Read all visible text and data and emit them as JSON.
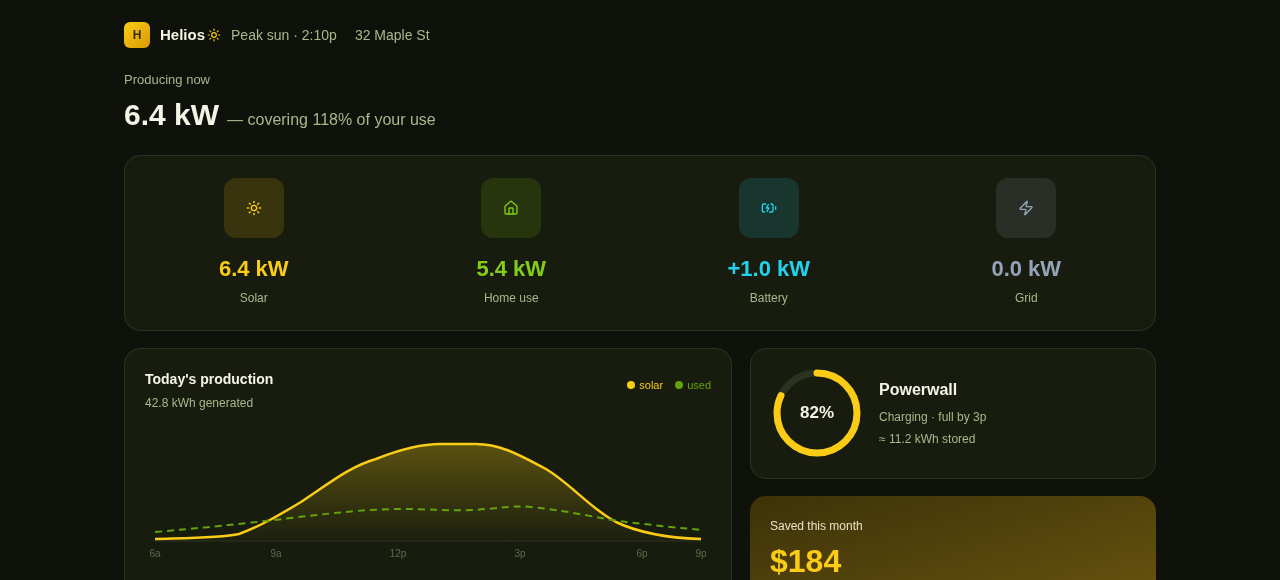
{
  "header": {
    "logo_letter": "H",
    "brand": "Helios",
    "status": "Peak sun · 2:10p",
    "address": "32 Maple St"
  },
  "hero": {
    "label": "Producing now",
    "value": "6.4 kW",
    "note": "— covering 118% of your use"
  },
  "flows": [
    {
      "kind": "solar",
      "value": "6.4 kW",
      "label": "Solar",
      "color": "#facc15"
    },
    {
      "kind": "home",
      "value": "5.4 kW",
      "label": "Home use",
      "color": "#84cc16"
    },
    {
      "kind": "battery",
      "value": "+1.0 kW",
      "label": "Battery",
      "color": "#22d3ee"
    },
    {
      "kind": "grid",
      "value": "0.0 kW",
      "label": "Grid",
      "color": "#94a3b8"
    }
  ],
  "production": {
    "title": "Today's production",
    "subtitle": "42.8 kWh generated",
    "legend": [
      {
        "label": "solar",
        "color": "#facc15"
      },
      {
        "label": "used",
        "color": "#65a30d"
      }
    ],
    "x_labels": [
      "6a",
      "9a",
      "12p",
      "3p",
      "6p",
      "9p"
    ]
  },
  "powerwall": {
    "level": 0.82,
    "percent": "82%",
    "title": "Powerwall",
    "status": "Charging · full by 3p",
    "stored": "≈ 11.2 kWh stored"
  },
  "savings": {
    "label": "Saved this month",
    "value": "$184"
  }
}
